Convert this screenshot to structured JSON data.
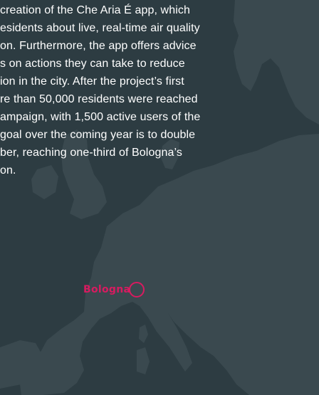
{
  "paragraph": {
    "lines": [
      " creation of the Che Aria É app, which",
      "esidents about live, real-time air quality",
      "on. Furthermore, the app offers advice",
      "s on actions they can take to reduce",
      "ion in the city. After the project’s first",
      "re than 50,000 residents were reached",
      "ampaign, with 1,500 active users of the",
      " goal over the coming year is to double",
      "ber, reaching one-third of Bologna’s",
      "on."
    ]
  },
  "map": {
    "city": {
      "name": "Bologna"
    },
    "colors": {
      "sea": "#2d3c42",
      "land": "#3a494f",
      "accent": "#d81b60",
      "text": "#ffffff"
    }
  }
}
